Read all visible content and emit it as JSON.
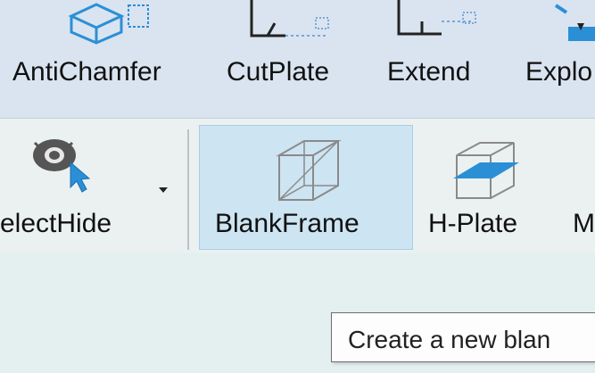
{
  "ribbon_top": {
    "items": [
      {
        "label": "AntiChamfer",
        "icon": "chamfer-box-icon"
      },
      {
        "label": "CutPlate",
        "icon": "cut-plate-icon"
      },
      {
        "label": "Extend",
        "icon": "extend-icon"
      },
      {
        "label": "Explo",
        "icon": "explode-icon"
      }
    ]
  },
  "ribbon_mid": {
    "items": [
      {
        "label": "electHide",
        "icon": "eye-cursor-icon"
      },
      {
        "label": "BlankFrame",
        "icon": "wireframe-cube-icon"
      },
      {
        "label": "H-Plate",
        "icon": "horizontal-plate-icon"
      },
      {
        "label": "M",
        "icon": "partial-icon"
      }
    ]
  },
  "tooltip": {
    "text": "Create a new blan"
  },
  "colors": {
    "accent_blue": "#2b8fd6",
    "highlight": "#cde4f2"
  }
}
